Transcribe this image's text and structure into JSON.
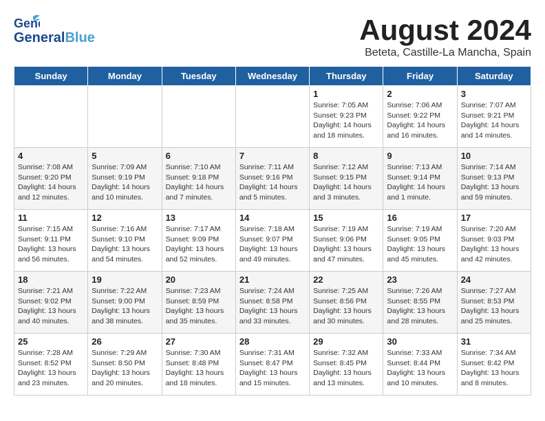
{
  "header": {
    "logo_general": "General",
    "logo_blue": "Blue",
    "month_year": "August 2024",
    "location": "Beteta, Castille-La Mancha, Spain"
  },
  "days_of_week": [
    "Sunday",
    "Monday",
    "Tuesday",
    "Wednesday",
    "Thursday",
    "Friday",
    "Saturday"
  ],
  "weeks": [
    [
      {
        "date": "",
        "info": ""
      },
      {
        "date": "",
        "info": ""
      },
      {
        "date": "",
        "info": ""
      },
      {
        "date": "",
        "info": ""
      },
      {
        "date": "1",
        "info": "Sunrise: 7:05 AM\nSunset: 9:23 PM\nDaylight: 14 hours\nand 18 minutes."
      },
      {
        "date": "2",
        "info": "Sunrise: 7:06 AM\nSunset: 9:22 PM\nDaylight: 14 hours\nand 16 minutes."
      },
      {
        "date": "3",
        "info": "Sunrise: 7:07 AM\nSunset: 9:21 PM\nDaylight: 14 hours\nand 14 minutes."
      }
    ],
    [
      {
        "date": "4",
        "info": "Sunrise: 7:08 AM\nSunset: 9:20 PM\nDaylight: 14 hours\nand 12 minutes."
      },
      {
        "date": "5",
        "info": "Sunrise: 7:09 AM\nSunset: 9:19 PM\nDaylight: 14 hours\nand 10 minutes."
      },
      {
        "date": "6",
        "info": "Sunrise: 7:10 AM\nSunset: 9:18 PM\nDaylight: 14 hours\nand 7 minutes."
      },
      {
        "date": "7",
        "info": "Sunrise: 7:11 AM\nSunset: 9:16 PM\nDaylight: 14 hours\nand 5 minutes."
      },
      {
        "date": "8",
        "info": "Sunrise: 7:12 AM\nSunset: 9:15 PM\nDaylight: 14 hours\nand 3 minutes."
      },
      {
        "date": "9",
        "info": "Sunrise: 7:13 AM\nSunset: 9:14 PM\nDaylight: 14 hours\nand 1 minute."
      },
      {
        "date": "10",
        "info": "Sunrise: 7:14 AM\nSunset: 9:13 PM\nDaylight: 13 hours\nand 59 minutes."
      }
    ],
    [
      {
        "date": "11",
        "info": "Sunrise: 7:15 AM\nSunset: 9:11 PM\nDaylight: 13 hours\nand 56 minutes."
      },
      {
        "date": "12",
        "info": "Sunrise: 7:16 AM\nSunset: 9:10 PM\nDaylight: 13 hours\nand 54 minutes."
      },
      {
        "date": "13",
        "info": "Sunrise: 7:17 AM\nSunset: 9:09 PM\nDaylight: 13 hours\nand 52 minutes."
      },
      {
        "date": "14",
        "info": "Sunrise: 7:18 AM\nSunset: 9:07 PM\nDaylight: 13 hours\nand 49 minutes."
      },
      {
        "date": "15",
        "info": "Sunrise: 7:19 AM\nSunset: 9:06 PM\nDaylight: 13 hours\nand 47 minutes."
      },
      {
        "date": "16",
        "info": "Sunrise: 7:19 AM\nSunset: 9:05 PM\nDaylight: 13 hours\nand 45 minutes."
      },
      {
        "date": "17",
        "info": "Sunrise: 7:20 AM\nSunset: 9:03 PM\nDaylight: 13 hours\nand 42 minutes."
      }
    ],
    [
      {
        "date": "18",
        "info": "Sunrise: 7:21 AM\nSunset: 9:02 PM\nDaylight: 13 hours\nand 40 minutes."
      },
      {
        "date": "19",
        "info": "Sunrise: 7:22 AM\nSunset: 9:00 PM\nDaylight: 13 hours\nand 38 minutes."
      },
      {
        "date": "20",
        "info": "Sunrise: 7:23 AM\nSunset: 8:59 PM\nDaylight: 13 hours\nand 35 minutes."
      },
      {
        "date": "21",
        "info": "Sunrise: 7:24 AM\nSunset: 8:58 PM\nDaylight: 13 hours\nand 33 minutes."
      },
      {
        "date": "22",
        "info": "Sunrise: 7:25 AM\nSunset: 8:56 PM\nDaylight: 13 hours\nand 30 minutes."
      },
      {
        "date": "23",
        "info": "Sunrise: 7:26 AM\nSunset: 8:55 PM\nDaylight: 13 hours\nand 28 minutes."
      },
      {
        "date": "24",
        "info": "Sunrise: 7:27 AM\nSunset: 8:53 PM\nDaylight: 13 hours\nand 25 minutes."
      }
    ],
    [
      {
        "date": "25",
        "info": "Sunrise: 7:28 AM\nSunset: 8:52 PM\nDaylight: 13 hours\nand 23 minutes."
      },
      {
        "date": "26",
        "info": "Sunrise: 7:29 AM\nSunset: 8:50 PM\nDaylight: 13 hours\nand 20 minutes."
      },
      {
        "date": "27",
        "info": "Sunrise: 7:30 AM\nSunset: 8:48 PM\nDaylight: 13 hours\nand 18 minutes."
      },
      {
        "date": "28",
        "info": "Sunrise: 7:31 AM\nSunset: 8:47 PM\nDaylight: 13 hours\nand 15 minutes."
      },
      {
        "date": "29",
        "info": "Sunrise: 7:32 AM\nSunset: 8:45 PM\nDaylight: 13 hours\nand 13 minutes."
      },
      {
        "date": "30",
        "info": "Sunrise: 7:33 AM\nSunset: 8:44 PM\nDaylight: 13 hours\nand 10 minutes."
      },
      {
        "date": "31",
        "info": "Sunrise: 7:34 AM\nSunset: 8:42 PM\nDaylight: 13 hours\nand 8 minutes."
      }
    ]
  ]
}
